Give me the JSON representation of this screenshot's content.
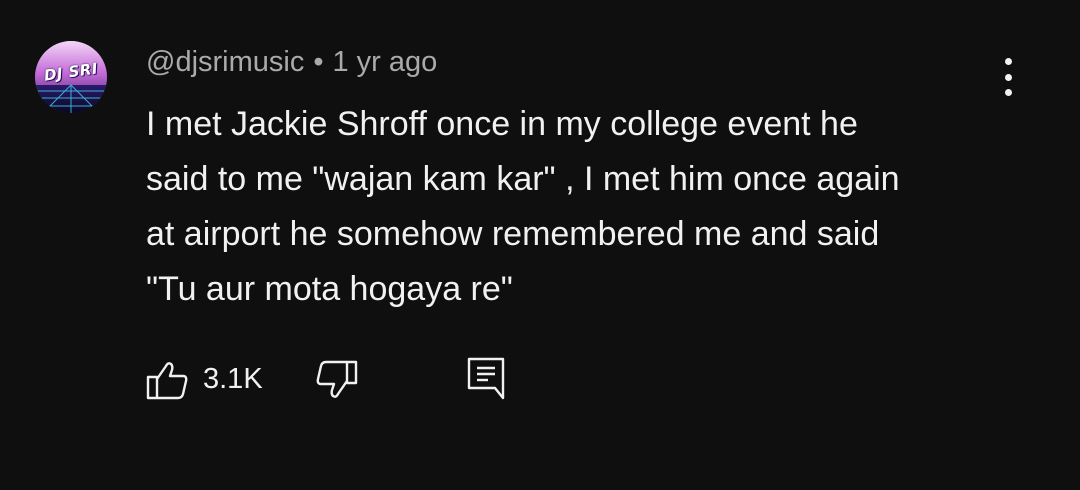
{
  "comment": {
    "avatar": {
      "text": "DJ SRI",
      "icon": "avatar-logo"
    },
    "author": "@djsrimusic",
    "separator": "•",
    "time": "1 yr ago",
    "body": "I met Jackie Shroff once in my college event he\nsaid to me \"wajan kam kar\" , I met him once again\nat airport he somehow remembered me and said\n\"Tu aur mota hogaya re\"",
    "likes": "3.1K",
    "icons": {
      "like": "thumbs-up-icon",
      "dislike": "thumbs-down-icon",
      "reply": "comment-reply-icon",
      "menu": "more-vertical-icon"
    }
  },
  "colors": {
    "background": "#0f0f0f",
    "text": "#f1f1f1",
    "meta": "#aaaaaa"
  }
}
